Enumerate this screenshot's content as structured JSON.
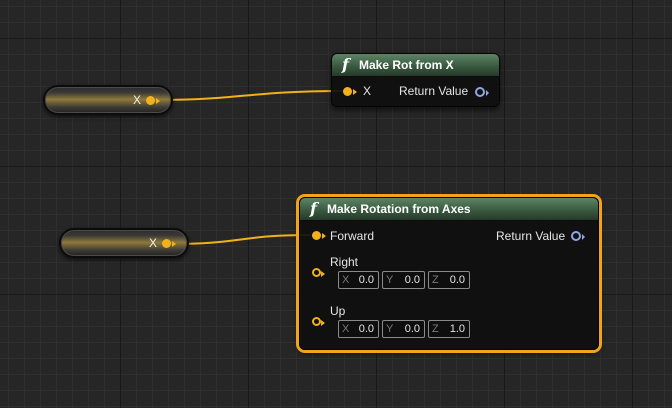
{
  "variable_nodes": [
    {
      "pin_label": "X"
    },
    {
      "pin_label": "X"
    }
  ],
  "make_rot_from_x": {
    "icon": "f",
    "title": "Make Rot from X",
    "input_label": "X",
    "output_label": "Return Value"
  },
  "make_rotation_from_axes": {
    "icon": "f",
    "title": "Make Rotation from Axes",
    "forward_label": "Forward",
    "output_label": "Return Value",
    "right": {
      "label": "Right",
      "x": {
        "axis": "X",
        "value": "0.0"
      },
      "y": {
        "axis": "Y",
        "value": "0.0"
      },
      "z": {
        "axis": "Z",
        "value": "0.0"
      }
    },
    "up": {
      "label": "Up",
      "x": {
        "axis": "X",
        "value": "0.0"
      },
      "y": {
        "axis": "Y",
        "value": "0.0"
      },
      "z": {
        "axis": "Z",
        "value": "1.0"
      }
    }
  },
  "colors": {
    "vector_pin": "#f2b11a",
    "rotator_pin": "#8fa7e0",
    "selection_outline": "#f2a31a",
    "function_header": "#395a40",
    "graph_background": "#262626"
  }
}
